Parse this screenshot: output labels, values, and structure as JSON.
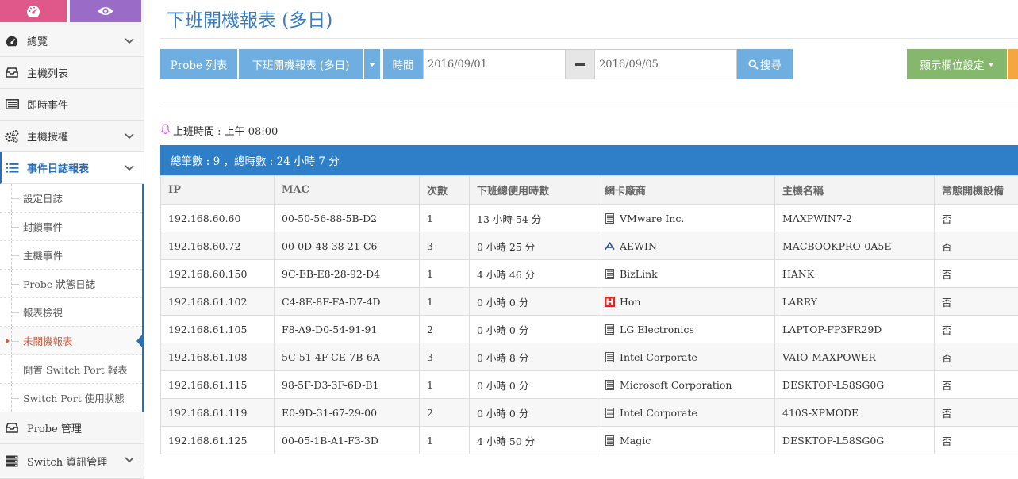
{
  "page": {
    "title": "下班開機報表 (多日)"
  },
  "sidebar": {
    "top_icons": [
      "dashboard-icon",
      "eye-icon"
    ],
    "items": [
      {
        "label": "總覽",
        "icon": "dashboard-icon",
        "has_chevron": true
      },
      {
        "label": "主機列表",
        "icon": "inbox-icon",
        "has_chevron": false
      },
      {
        "label": "即時事件",
        "icon": "list-icon",
        "has_chevron": false
      },
      {
        "label": "主機授權",
        "icon": "gears-icon",
        "has_chevron": true
      },
      {
        "label": "事件日誌報表",
        "icon": "list-icon",
        "has_chevron": true,
        "active": true
      }
    ],
    "sub_items": [
      "設定日誌",
      "封鎖事件",
      "主機事件",
      "Probe 狀態日誌",
      "報表檢視",
      "未關機報表",
      "閒置 Switch Port 報表",
      "Switch Port 使用狀態"
    ],
    "current_sub": "未關機報表",
    "bottom_items": [
      {
        "label": "Probe 管理",
        "icon": "inbox-icon"
      },
      {
        "label": "Switch 資訊管理",
        "icon": "server-icon",
        "has_chevron": true
      }
    ]
  },
  "toolbar": {
    "probe_list": "Probe 列表",
    "report_select": "下班開機報表 (多日)",
    "time_label": "時間",
    "date_start": "2016/09/01",
    "date_end": "2016/09/05",
    "search": "搜尋",
    "columns_setting": "顯示欄位設定"
  },
  "work_time": "上班時間 : 上午 08:00",
  "summary": "總筆數 : 9 ，總時數 : 24 小時 7 分",
  "table": {
    "headers": [
      "IP",
      "MAC",
      "次數",
      "下班總使用時數",
      "網卡廠商",
      "主機名稱",
      "常態開機設備"
    ],
    "rows": [
      {
        "ip": "192.168.60.60",
        "mac": "00-50-56-88-5B-D2",
        "count": "1",
        "hours": "13 小時 54 分",
        "vendor": "VMware Inc.",
        "vendor_icon": "generic",
        "host": "MAXPWIN7-2",
        "always_on": "否"
      },
      {
        "ip": "192.168.60.72",
        "mac": "00-0D-48-38-21-C6",
        "count": "3",
        "hours": "0 小時 25 分",
        "vendor": "AEWIN",
        "vendor_icon": "aewin",
        "host": "MACBOOKPRO-0A5E",
        "always_on": "否"
      },
      {
        "ip": "192.168.60.150",
        "mac": "9C-EB-E8-28-92-D4",
        "count": "1",
        "hours": "4 小時 46 分",
        "vendor": "BizLink",
        "vendor_icon": "generic",
        "host": "HANK",
        "always_on": "否"
      },
      {
        "ip": "192.168.61.102",
        "mac": "C4-8E-8F-FA-D7-4D",
        "count": "1",
        "hours": "0 小時 0 分",
        "vendor": "Hon",
        "vendor_icon": "hon",
        "host": "LARRY",
        "always_on": "否"
      },
      {
        "ip": "192.168.61.105",
        "mac": "F8-A9-D0-54-91-91",
        "count": "2",
        "hours": "0 小時 0 分",
        "vendor": "LG Electronics",
        "vendor_icon": "generic",
        "host": "LAPTOP-FP3FR29D",
        "always_on": "否"
      },
      {
        "ip": "192.168.61.108",
        "mac": "5C-51-4F-CE-7B-6A",
        "count": "3",
        "hours": "0 小時 8 分",
        "vendor": "Intel Corporate",
        "vendor_icon": "generic",
        "host": "VAIO-MAXPOWER",
        "always_on": "否"
      },
      {
        "ip": "192.168.61.115",
        "mac": "98-5F-D3-3F-6D-B1",
        "count": "1",
        "hours": "0 小時 0 分",
        "vendor": "Microsoft Corporation",
        "vendor_icon": "generic",
        "host": "DESKTOP-L58SG0G",
        "always_on": "否"
      },
      {
        "ip": "192.168.61.119",
        "mac": "E0-9D-31-67-29-00",
        "count": "2",
        "hours": "0 小時 0 分",
        "vendor": "Intel Corporate",
        "vendor_icon": "generic",
        "host": "410S-XPMODE",
        "always_on": "否"
      },
      {
        "ip": "192.168.61.125",
        "mac": "00-05-1B-A1-F3-3D",
        "count": "1",
        "hours": "4 小時 50 分",
        "vendor": "Magic",
        "vendor_icon": "generic",
        "host": "DESKTOP-L58SG0G",
        "always_on": "否"
      }
    ]
  },
  "colors": {
    "accent": "#2f7fc8",
    "toolbar_blue": "#6faee0",
    "green": "#85b86d",
    "orange": "#f4a640",
    "pink": "#e0588a",
    "purple": "#9a6bc7"
  }
}
